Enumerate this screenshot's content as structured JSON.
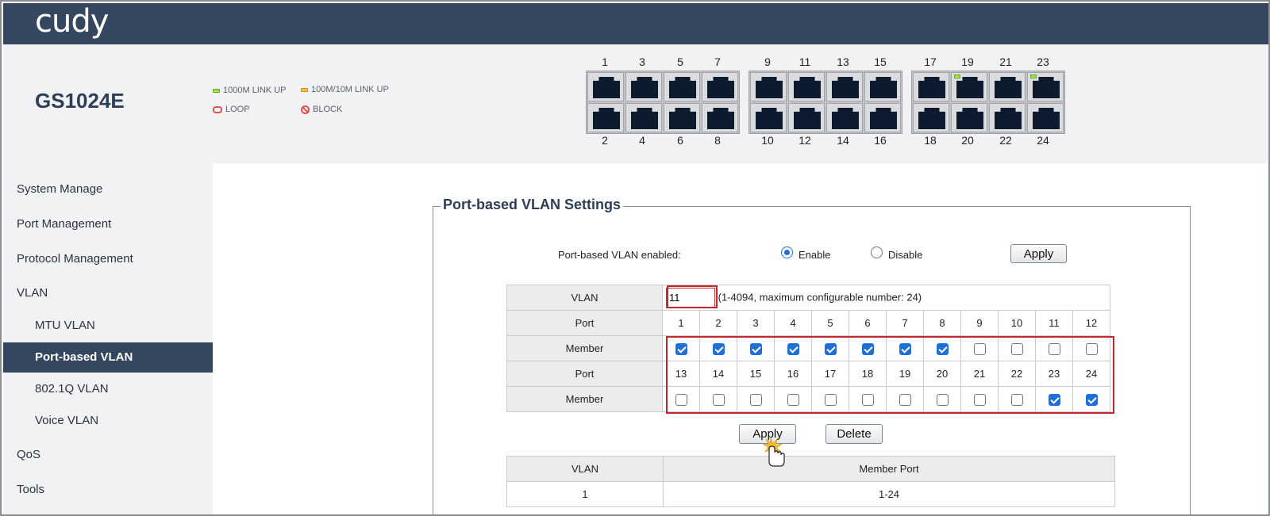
{
  "header": {
    "logo": "cudy"
  },
  "device": {
    "model": "GS1024E",
    "legend": {
      "link_1000": "1000M LINK UP",
      "link_100": "100M/10M LINK UP",
      "loop": "LOOP",
      "block": "BLOCK"
    },
    "top_port_numbers": [
      "1",
      "3",
      "5",
      "7",
      "9",
      "11",
      "13",
      "15",
      "17",
      "19",
      "21",
      "23"
    ],
    "bottom_port_numbers": [
      "2",
      "4",
      "6",
      "8",
      "10",
      "12",
      "14",
      "16",
      "18",
      "20",
      "22",
      "24"
    ],
    "linked_ports": [
      19,
      23
    ],
    "colors": {
      "header": "#34475f",
      "link_green": "#9ee34b",
      "link_yellow": "#f3c33a",
      "alert_red": "#e05050"
    }
  },
  "sidebar": {
    "items": [
      {
        "label": "System Manage"
      },
      {
        "label": "Port Management"
      },
      {
        "label": "Protocol Management"
      },
      {
        "label": "VLAN"
      },
      {
        "label": "MTU VLAN"
      },
      {
        "label": "Port-based VLAN"
      },
      {
        "label": "802.1Q VLAN"
      },
      {
        "label": "Voice VLAN"
      },
      {
        "label": "QoS"
      },
      {
        "label": "Tools"
      }
    ],
    "active": "Port-based VLAN"
  },
  "main": {
    "title": "Port-based VLAN Settings",
    "enabled_label": "Port-based VLAN enabled:",
    "enable_label": "Enable",
    "disable_label": "Disable",
    "enabled_state": "Enable",
    "apply_top": "Apply",
    "vlan_label": "VLAN",
    "vlan_value": "11",
    "vlan_hint": "(1-4094, maximum configurable number: 24)",
    "port_label": "Port",
    "member_label": "Member",
    "ports_row1": [
      "1",
      "2",
      "3",
      "4",
      "5",
      "6",
      "7",
      "8",
      "9",
      "10",
      "11",
      "12"
    ],
    "ports_row2": [
      "13",
      "14",
      "15",
      "16",
      "17",
      "18",
      "19",
      "20",
      "21",
      "22",
      "23",
      "24"
    ],
    "members_row1": [
      true,
      true,
      true,
      true,
      true,
      true,
      true,
      true,
      false,
      false,
      false,
      false
    ],
    "members_row2": [
      false,
      false,
      false,
      false,
      false,
      false,
      false,
      false,
      false,
      false,
      true,
      true
    ],
    "apply_label": "Apply",
    "delete_label": "Delete",
    "list": {
      "col_vlan": "VLAN",
      "col_members": "Member Port",
      "rows": [
        {
          "vlan": "1",
          "members": "1-24"
        }
      ]
    }
  }
}
